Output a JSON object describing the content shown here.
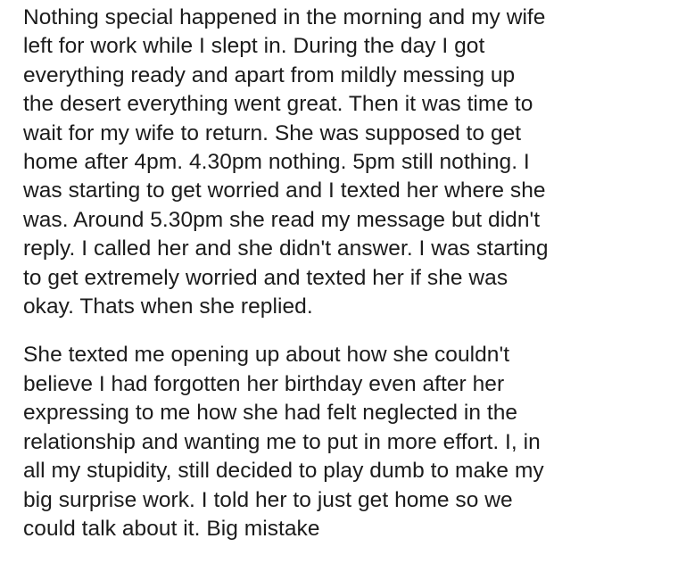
{
  "paragraphs": [
    {
      "lines": [
        "Nothing special happened in the morning and my wife",
        "left for work while I slept in. During the day I got",
        "everything ready and apart from mildly messing up",
        "the desert everything went great. Then it was time to",
        "wait for my wife to return. She was supposed to get",
        "home after 4pm. 4.30pm nothing. 5pm still nothing. I",
        "was starting to get worried and I texted her where she",
        "was. Around 5.30pm she read my message but didn't",
        "reply. I called her and she didn't answer. I was starting",
        "to get extremely worried and texted her if she was",
        "okay. Thats when she replied."
      ]
    },
    {
      "lines": [
        "She texted me opening up about how she couldn't",
        "believe I had forgotten her birthday even after her",
        "expressing to me how she had felt neglected in the",
        "relationship and wanting me to put in more effort. I, in",
        "all my stupidity, still decided to play dumb to make my",
        "big surprise work. I told her to just get home so we",
        "could talk about it. Big mistake"
      ]
    }
  ]
}
